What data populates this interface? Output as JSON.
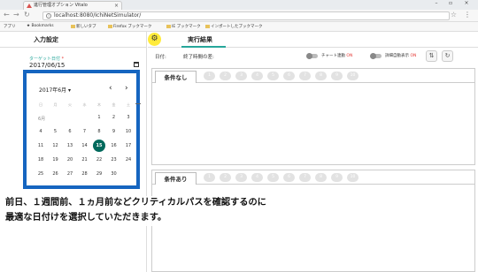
{
  "browser": {
    "tab_title": "進行管理オプション Vitalo",
    "url": "localhost:8080/IchiNetSimulator/",
    "bookmarks": [
      "アプリ",
      "Bookmarks",
      "新しいタブ",
      "Firefox ブックマーク",
      "IE ブックマーク",
      "インポートしたブックマーク"
    ]
  },
  "left_panel": {
    "title": "入力設定",
    "field_label": "ターゲット日付",
    "required_mark": "*",
    "field_value": "2017/06/15"
  },
  "date_picker": {
    "month_label": "2017年6月",
    "prev": "‹",
    "next": "›",
    "weekdays": [
      "日",
      "月",
      "火",
      "水",
      "木",
      "金",
      "土"
    ],
    "month_short": "6月",
    "weeks": [
      [
        "",
        "",
        "",
        "",
        "1",
        "2",
        "3"
      ],
      [
        "4",
        "5",
        "6",
        "7",
        "8",
        "9",
        "10"
      ],
      [
        "11",
        "12",
        "13",
        "14",
        "15",
        "16",
        "17"
      ],
      [
        "18",
        "19",
        "20",
        "21",
        "22",
        "23",
        "24"
      ],
      [
        "25",
        "26",
        "27",
        "28",
        "29",
        "30",
        ""
      ]
    ],
    "selected_day": "15"
  },
  "right_panel": {
    "title": "実行結果",
    "date_label": "日付:",
    "end_time_label": "終了時間の差:",
    "toggle1_label": "チャート連動",
    "toggle1_state": "ON",
    "toggle2_label": "詳細自動表示",
    "toggle2_state": "ON",
    "btn_updown": "⇅",
    "btn_refresh": "↻"
  },
  "result_boxes": {
    "box1_tab": "条件なし",
    "box2_tab": "条件あり",
    "pills": [
      "1",
      "2",
      "3",
      "4",
      "5",
      "6",
      "7",
      "8",
      "9",
      "10"
    ]
  },
  "caption": {
    "line1": "前日、１週間前、１ヵ月前などクリティカルパスを確認するのに",
    "line2": "最適な日付けを選択していただきます。"
  }
}
